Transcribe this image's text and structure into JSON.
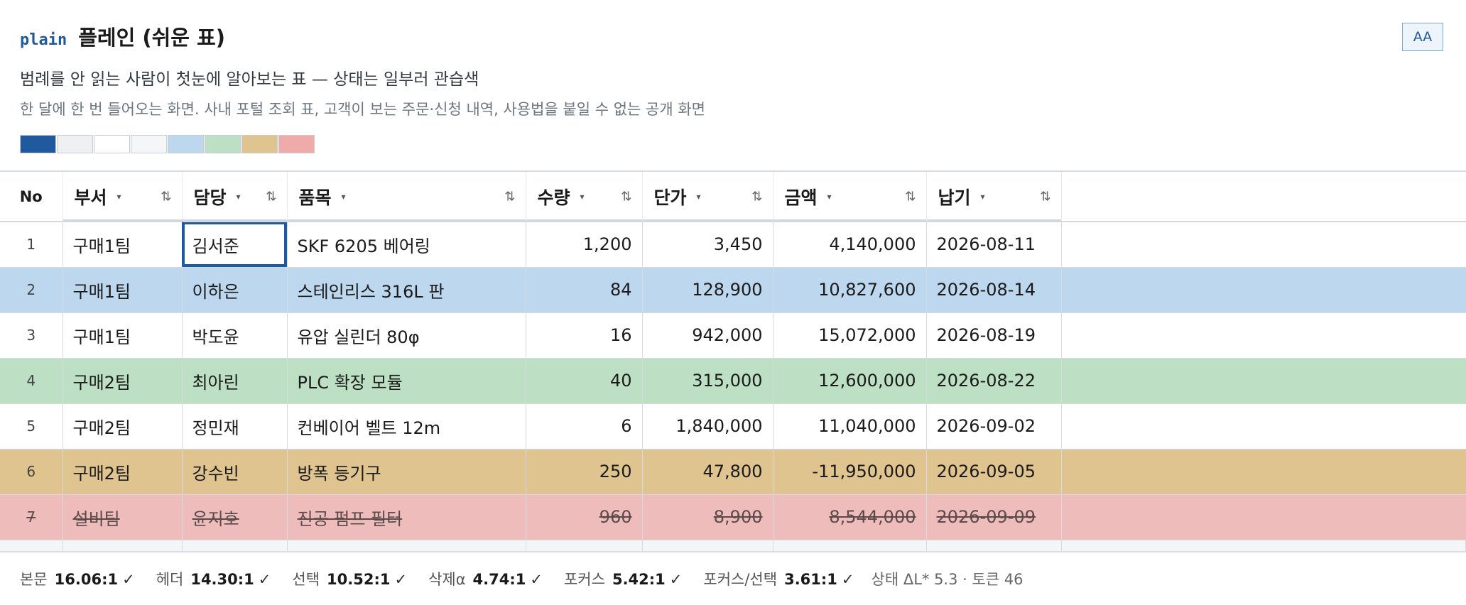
{
  "header": {
    "tag": "plain",
    "title": "플레인 (쉬운 표)",
    "subtitle": "범례를 안 읽는 사람이 첫눈에 알아보는 표 — 상태는 일부러 관습색",
    "description": "한 달에 한 번 들어오는 화면. 사내 포털 조회 표, 고객이 보는 주문·신청 내역, 사용법을 붙일 수 없는 공개 화면",
    "aa_label": "AA",
    "swatches": [
      "#1f5a9e",
      "#eef0f2",
      "#ffffff",
      "#f5f6f8",
      "#bdd7ee",
      "#bde0c4",
      "#dfc48f",
      "#efaaaa"
    ]
  },
  "table": {
    "columns": [
      {
        "label": "No"
      },
      {
        "label": "부서"
      },
      {
        "label": "담당"
      },
      {
        "label": "품목"
      },
      {
        "label": "수량"
      },
      {
        "label": "단가"
      },
      {
        "label": "금액"
      },
      {
        "label": "납기"
      }
    ],
    "caret": "▾",
    "sort_icon": "⇅",
    "rows": [
      {
        "no": "1",
        "dept": "구매1팀",
        "owner": "김서준",
        "item": "SKF 6205 베어링",
        "qty": "1,200",
        "price": "3,450",
        "amount": "4,140,000",
        "due": "2026-08-11",
        "state": "none"
      },
      {
        "no": "2",
        "dept": "구매1팀",
        "owner": "이하은",
        "item": "스테인리스 316L 판",
        "qty": "84",
        "price": "128,900",
        "amount": "10,827,600",
        "due": "2026-08-14",
        "state": "selected"
      },
      {
        "no": "3",
        "dept": "구매1팀",
        "owner": "박도윤",
        "item": "유압 실린더 80φ",
        "qty": "16",
        "price": "942,000",
        "amount": "15,072,000",
        "due": "2026-08-19",
        "state": "none"
      },
      {
        "no": "4",
        "dept": "구매2팀",
        "owner": "최아린",
        "item": "PLC 확장 모듈",
        "qty": "40",
        "price": "315,000",
        "amount": "12,600,000",
        "due": "2026-08-22",
        "state": "green"
      },
      {
        "no": "5",
        "dept": "구매2팀",
        "owner": "정민재",
        "item": "컨베이어 벨트 12m",
        "qty": "6",
        "price": "1,840,000",
        "amount": "11,040,000",
        "due": "2026-09-02",
        "state": "none"
      },
      {
        "no": "6",
        "dept": "구매2팀",
        "owner": "강수빈",
        "item": "방폭 등기구",
        "qty": "250",
        "price": "47,800",
        "amount": "-11,950,000",
        "due": "2026-09-05",
        "state": "warn"
      },
      {
        "no": "7",
        "dept": "설비팀",
        "owner": "윤지호",
        "item": "진공 펌프 필터",
        "qty": "960",
        "price": "8,900",
        "amount": "8,544,000",
        "due": "2026-09-09",
        "state": "deleted"
      }
    ]
  },
  "footer": {
    "metrics": [
      {
        "label": "본문",
        "value": "16.06:1",
        "mark": "✓"
      },
      {
        "label": "헤더",
        "value": "14.30:1",
        "mark": "✓"
      },
      {
        "label": "선택",
        "value": "10.52:1",
        "mark": "✓"
      },
      {
        "label": "삭제α",
        "value": "4.74:1",
        "mark": "✓"
      },
      {
        "label": "포커스",
        "value": "5.42:1",
        "mark": "✓"
      },
      {
        "label": "포커스/선택",
        "value": "3.61:1",
        "mark": "✓"
      }
    ],
    "status_text": "상태 ΔL* 5.3 · 토큰 46"
  }
}
